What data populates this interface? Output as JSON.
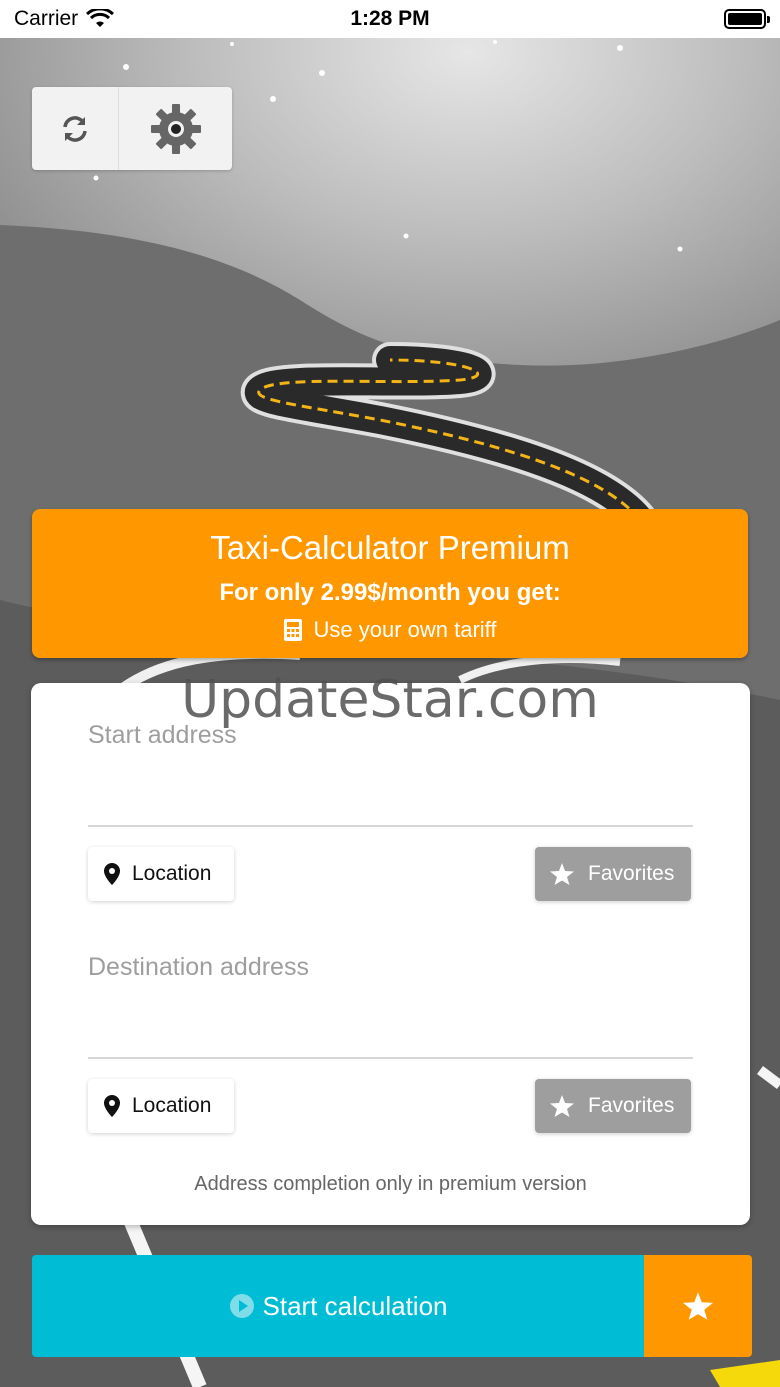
{
  "status_bar": {
    "carrier": "Carrier",
    "time": "1:28 PM"
  },
  "toolbar": {
    "refresh_icon": "refresh-icon",
    "settings_icon": "gear-icon"
  },
  "premium": {
    "title": "Taxi-Calculator Premium",
    "subtitle": "For only 2.99$/month you get:",
    "feature": "Use your own tariff",
    "color": "#ff9800"
  },
  "watermark": "UpdateStar.com",
  "address": {
    "start_placeholder": "Start address",
    "destination_placeholder": "Destination address",
    "location_label": "Location",
    "favorites_label": "Favorites",
    "note": "Address completion only in premium version"
  },
  "actions": {
    "start_label": "Start calculation",
    "start_color": "#00bcd4",
    "favorite_color": "#ff9800"
  }
}
